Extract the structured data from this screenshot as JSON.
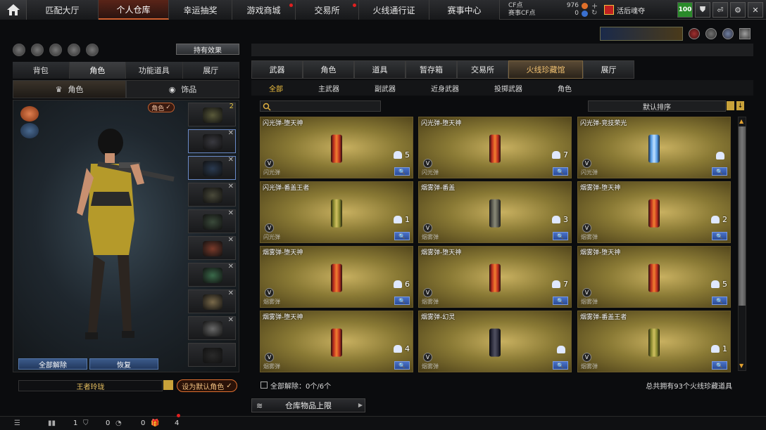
{
  "topnav": {
    "tabs": [
      {
        "label": "匹配大厅"
      },
      {
        "label": "个人仓库"
      },
      {
        "label": "幸运抽奖"
      },
      {
        "label": "游戏商城"
      },
      {
        "label": "交易所"
      },
      {
        "label": "火线通行证"
      },
      {
        "label": "赛事中心"
      }
    ],
    "cf_label": "CF点",
    "cf_value": "976",
    "cfcoin_label": "赛事CF点",
    "cfcoin_value": "0",
    "username": "活后魂夺",
    "level": "100"
  },
  "left": {
    "hold_effect": "持有效果",
    "tabs": [
      "背包",
      "角色",
      "功能道具",
      "展厅"
    ],
    "subtabs": [
      "角色",
      "饰品"
    ],
    "char_badge": "角色",
    "slot1_count": "2",
    "remove_all": "全部解除",
    "restore": "恢复",
    "char_name": "王者玲珑",
    "set_default": "设为默认角色"
  },
  "right": {
    "tabs": [
      "武器",
      "角色",
      "道具",
      "暂存箱",
      "交易所",
      "火线珍藏馆",
      "展厅"
    ],
    "subtabs": [
      "全部",
      "主武器",
      "副武器",
      "近身武器",
      "投掷武器",
      "角色"
    ],
    "sort_label": "默认排序",
    "items": [
      {
        "title": "闪光弹-堕天神",
        "cat": "闪光弹",
        "count": "5",
        "color": "g-red"
      },
      {
        "title": "闪光弹-堕天神",
        "cat": "闪光弹",
        "count": "7",
        "color": "g-red"
      },
      {
        "title": "闪光弹-竞技荣光",
        "cat": "闪光弹",
        "count": "",
        "color": "g-blue"
      },
      {
        "title": "闪光弹-番盖王者",
        "cat": "闪光弹",
        "count": "1",
        "color": "g-yellow"
      },
      {
        "title": "烟雾弹-番盖",
        "cat": "烟雾弹",
        "count": "3",
        "color": "g-gray"
      },
      {
        "title": "烟雾弹-堕天神",
        "cat": "烟雾弹",
        "count": "2",
        "color": "g-red"
      },
      {
        "title": "烟雾弹-堕天神",
        "cat": "烟雾弹",
        "count": "6",
        "color": "g-red"
      },
      {
        "title": "烟雾弹-堕天神",
        "cat": "烟雾弹",
        "count": "7",
        "color": "g-red"
      },
      {
        "title": "烟雾弹-堕天神",
        "cat": "烟雾弹",
        "count": "5",
        "color": "g-red"
      },
      {
        "title": "烟雾弹-堕天神",
        "cat": "烟雾弹",
        "count": "4",
        "color": "g-red"
      },
      {
        "title": "烟雾弹-幻灵",
        "cat": "烟雾弹",
        "count": "",
        "color": "g-dark"
      },
      {
        "title": "烟雾弹-番盖王者",
        "cat": "烟雾弹",
        "count": "1",
        "color": "g-yellow"
      }
    ],
    "footer_left": "全部解除：0个/6个",
    "footer_right": "总共拥有93个火线珍藏道具",
    "storage_button": "仓库物品上限"
  },
  "bottom": {
    "count1": "1",
    "count2": "0",
    "count3": "0",
    "count4": "4"
  }
}
